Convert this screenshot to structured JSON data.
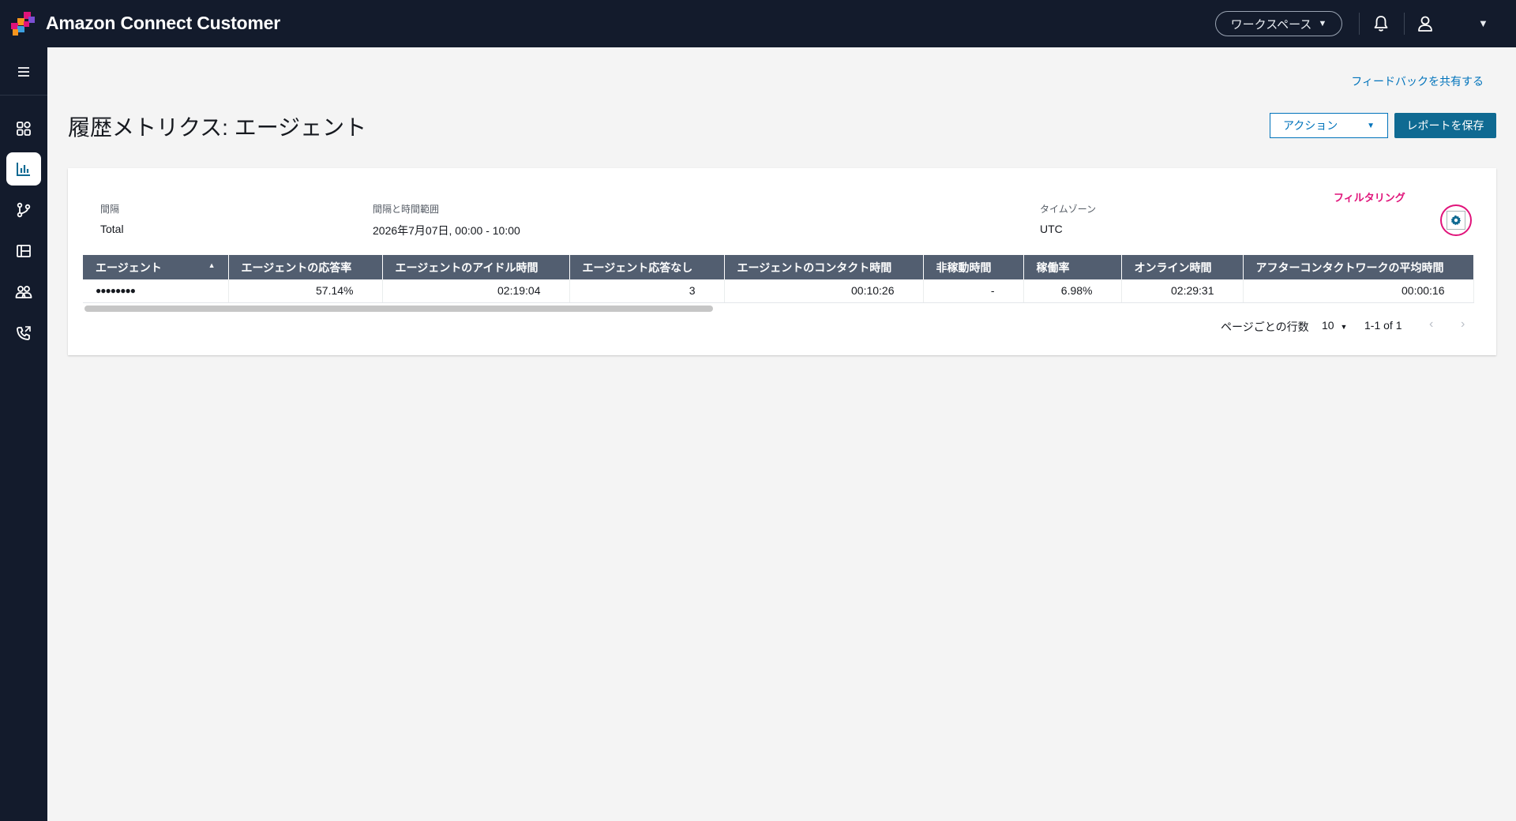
{
  "header": {
    "app_title": "Amazon Connect Customer",
    "workspace_label": "ワークスペース",
    "brand_colors": [
      "#e0137a",
      "#f7941d",
      "#3c9fe0",
      "#7b4fd3"
    ]
  },
  "sidebar": {
    "items": [
      {
        "icon": "menu-icon",
        "active": false
      },
      {
        "icon": "dashboard-icon",
        "active": false
      },
      {
        "icon": "bar-chart-icon",
        "active": true
      },
      {
        "icon": "flow-branch-icon",
        "active": false
      },
      {
        "icon": "layout-panel-icon",
        "active": false
      },
      {
        "icon": "users-icon",
        "active": false
      },
      {
        "icon": "phone-routing-icon",
        "active": false
      }
    ]
  },
  "page": {
    "feedback_link": "フィードバックを共有する",
    "title": "履歴メトリクス: エージェント",
    "action_label": "アクション",
    "save_label": "レポートを保存"
  },
  "report_meta": {
    "interval_label": "間隔",
    "interval_value": "Total",
    "range_label": "間隔と時間範囲",
    "range_value": "2026年7月07日, 00:00 - 10:00",
    "timezone_label": "タイムゾーン",
    "timezone_value": "UTC",
    "filter_label": "フィルタリング"
  },
  "table": {
    "columns": [
      "エージェント",
      "エージェントの応答率",
      "エージェントのアイドル時間",
      "エージェント応答なし",
      "エージェントのコンタクト時間",
      "非稼動時間",
      "稼働率",
      "オンライン時間",
      "アフターコンタクトワークの平均時間"
    ],
    "rows": [
      [
        "●●●●●●●●",
        "57.14%",
        "02:19:04",
        "3",
        "00:10:26",
        "-",
        "6.98%",
        "02:29:31",
        "00:00:16"
      ]
    ]
  },
  "pagination": {
    "rows_per_page_label": "ページごとの行数",
    "rows_per_page_value": "10",
    "range_text": "1-1 of 1"
  }
}
